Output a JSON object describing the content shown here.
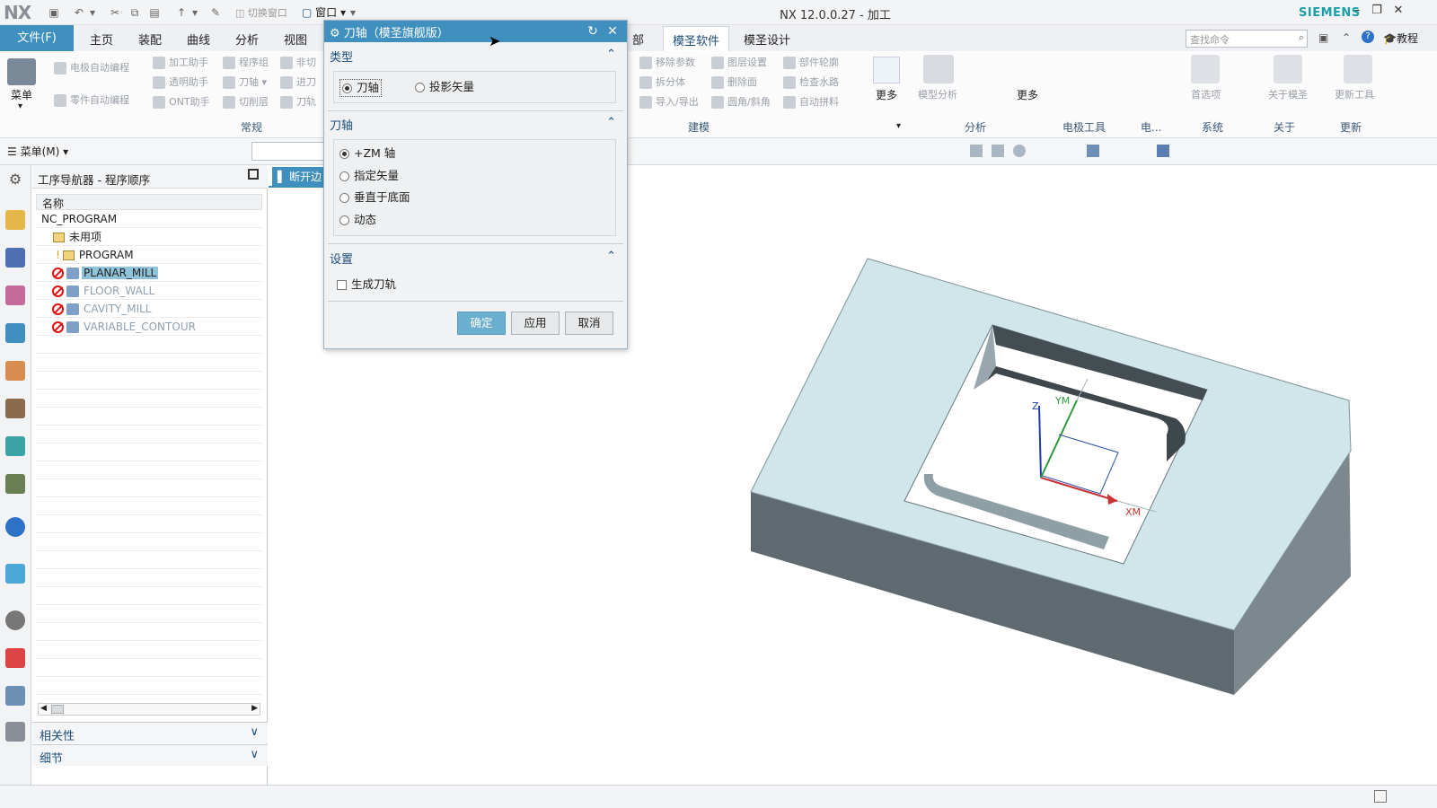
{
  "app": {
    "logo": "NX",
    "title": "NX 12.0.0.27 - 加工",
    "brand": "SIEMENS",
    "quick_switch_window": "切换窗口",
    "quick_window": "窗口"
  },
  "menu": {
    "file": "文件(F)",
    "tabs": [
      "主页",
      "装配",
      "曲线",
      "分析",
      "视图"
    ],
    "tab_partial": "部",
    "active_tab": "模圣软件",
    "tab_after": "模圣设计",
    "search_placeholder": "查找命令",
    "tutorial": "教程"
  },
  "ribbon": {
    "big_menu": "菜单",
    "items": [
      "电极自动编程",
      "零件自动编程",
      "加工助手",
      "透明助手",
      "ONT助手",
      "程序组",
      "刀轴",
      "切削层",
      "非切",
      "进刀",
      "刀轨"
    ],
    "group_normal": "常规",
    "modeling_items": [
      "移除参数",
      "拆分体",
      "导入/导出",
      "图层设置",
      "删除面",
      "圆角/斜角",
      "部件轮廓",
      "检查水路",
      "自动拼料"
    ],
    "group_modeling": "建模",
    "more1": "更多",
    "model_analysis": "模型分析",
    "more2": "更多",
    "group_analysis": "分析",
    "group_electrode": "电极工具",
    "group_elec2": "电...",
    "prefs": "首选项",
    "group_system": "系统",
    "about": "关于模圣",
    "group_about": "关于",
    "update_tool": "更新工具",
    "group_update": "更新"
  },
  "toolbar2": {
    "menu_button": "菜单(M)"
  },
  "navigator": {
    "title": "工序导航器 - 程序顺序",
    "col_name": "名称",
    "rows": [
      {
        "label": "NC_PROGRAM"
      },
      {
        "label": "未用项"
      },
      {
        "label": "PROGRAM"
      },
      {
        "label": "PLANAR_MILL"
      },
      {
        "label": "FLOOR_WALL"
      },
      {
        "label": "CAVITY_MILL"
      },
      {
        "label": "VARIABLE_CONTOUR"
      }
    ],
    "panel_dependency": "相关性",
    "panel_details": "细节"
  },
  "graphics": {
    "tab_label": "断开边",
    "axis_zm": "Z",
    "axis_ym": "YM",
    "axis_xm": "XM"
  },
  "dialog": {
    "title": "刀轴（模圣旗舰版）",
    "section_type": "类型",
    "type_options": [
      "刀轴",
      "投影矢量"
    ],
    "section_axis": "刀轴",
    "axis_options": [
      "+ZM 轴",
      "指定矢量",
      "垂直于底面",
      "动态"
    ],
    "section_settings": "设置",
    "generate_toolpath": "生成刀轨",
    "ok": "确定",
    "apply": "应用",
    "cancel": "取消"
  },
  "colors": {
    "accent": "#3f8fbf",
    "selected_row": "#8fc3d9",
    "part_top": "#d0e6ea",
    "part_side": "#5f6a70"
  }
}
